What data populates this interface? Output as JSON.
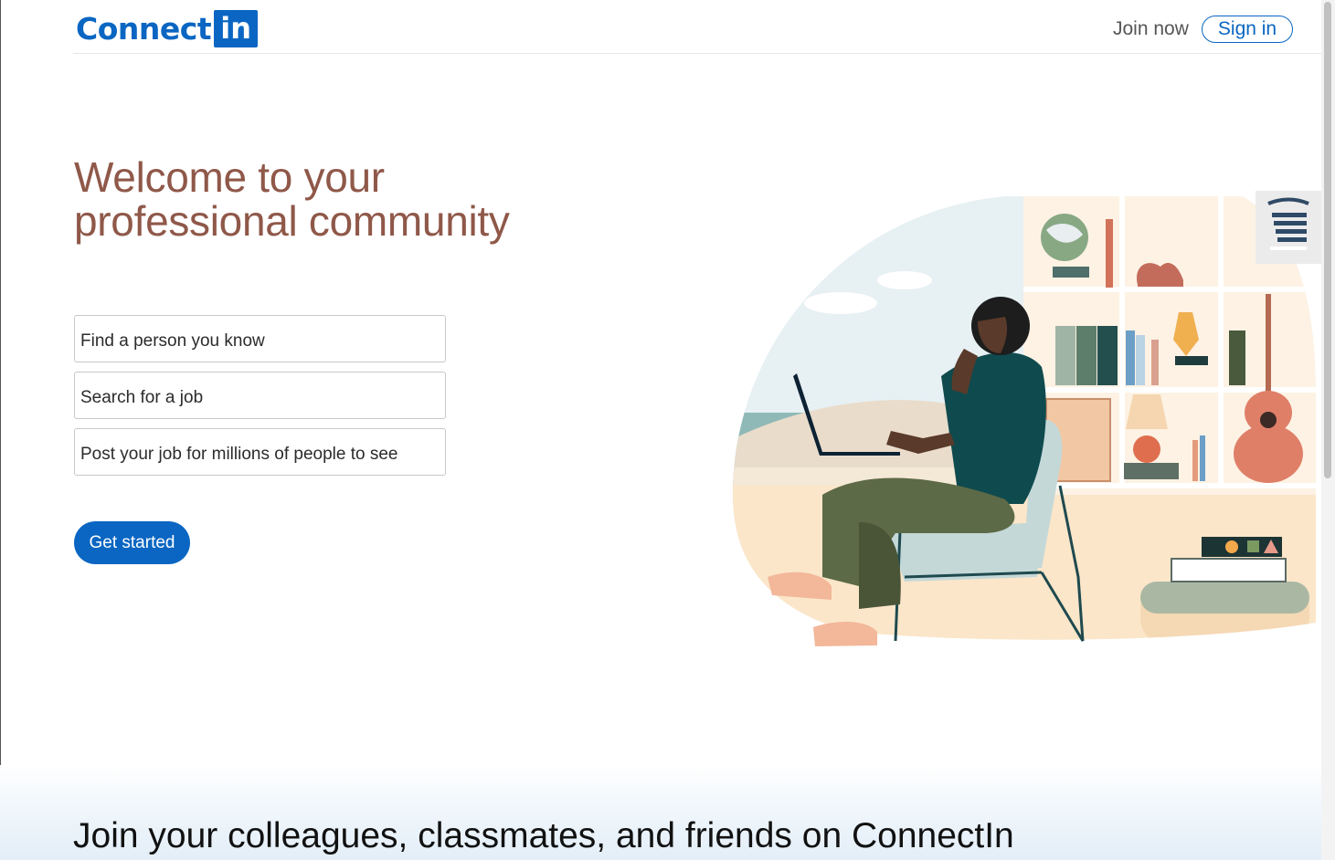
{
  "header": {
    "logo_text": "Connect",
    "logo_badge": "in",
    "join_now": "Join now",
    "sign_in": "Sign in"
  },
  "hero": {
    "headline_line1": "Welcome to your",
    "headline_line2": "professional community",
    "options": [
      "Find a person you know",
      "Search for a job",
      "Post your job for millions of people to see"
    ],
    "cta": "Get started"
  },
  "footer": {
    "tagline": "Join your colleagues, classmates, and friends on ConnectIn"
  },
  "colors": {
    "brand": "#0a66c2",
    "headline": "#8f5849",
    "text": "#111111"
  },
  "icons": {
    "side_widget": "layers-icon",
    "hero_image": "person-with-laptop-illustration"
  }
}
